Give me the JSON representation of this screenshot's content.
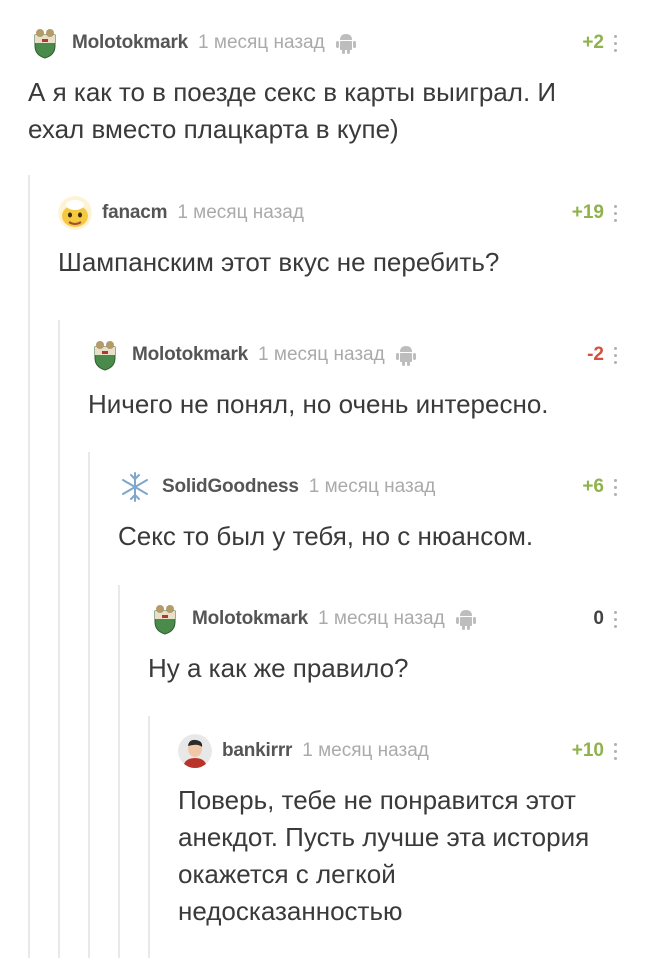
{
  "comments": [
    {
      "author": "Molotokmark",
      "time": "1 месяц назад",
      "rating": "+2",
      "rating_type": "pos",
      "android": true,
      "avatar_icon": "shield-crest-icon",
      "text": "А я как то в поезде секс в карты выиграл. И ехал вместо плацкарта в купе)"
    },
    {
      "author": "fanacm",
      "time": "1 месяц назад",
      "rating": "+19",
      "rating_type": "pos",
      "android": false,
      "avatar_icon": "cartoon-face-icon",
      "text": "Шампанским этот вкус не перебить?"
    },
    {
      "author": "Molotokmark",
      "time": "1 месяц назад",
      "rating": "-2",
      "rating_type": "neg",
      "android": true,
      "avatar_icon": "shield-crest-icon",
      "text": "Ничего не понял, но очень интересно."
    },
    {
      "author": "SolidGoodness",
      "time": "1 месяц назад",
      "rating": "+6",
      "rating_type": "pos",
      "android": false,
      "avatar_icon": "snowflake-icon",
      "text": "Секс то был у тебя, но с нюансом."
    },
    {
      "author": "Molotokmark",
      "time": "1 месяц назад",
      "rating": "0",
      "rating_type": "zero",
      "android": true,
      "avatar_icon": "shield-crest-icon",
      "text": "Ну а как же правило?"
    },
    {
      "author": "bankirrr",
      "time": "1 месяц назад",
      "rating": "+10",
      "rating_type": "pos",
      "android": false,
      "avatar_icon": "person-avatar-icon",
      "text": "Поверь, тебе не понравится этот анекдот. Пусть лучше эта история окажется с легкой недосказанностью"
    }
  ],
  "colors": {
    "positive": "#8fb24d",
    "negative": "#d5523a",
    "thread_line": "#e9e9e9"
  }
}
